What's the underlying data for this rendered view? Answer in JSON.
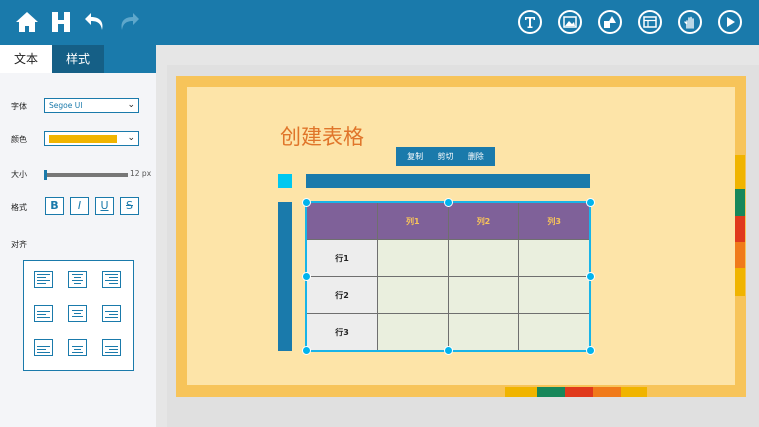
{
  "toolbar": {
    "left_icons": [
      "home-icon",
      "save-icon",
      "undo-icon",
      "redo-icon"
    ],
    "right_icons": [
      "text-icon",
      "image-icon",
      "shapes-icon",
      "table-icon",
      "gesture-icon",
      "play-icon"
    ]
  },
  "tabs": {
    "text": "文本",
    "style": "样式"
  },
  "props": {
    "font_label": "字体",
    "font_value": "Segoe UI",
    "color_label": "颜色",
    "color_value": "#f0b400",
    "size_label": "大小",
    "size_value": "12 px",
    "format_label": "格式",
    "format_buttons": [
      "B",
      "I",
      "U",
      "S"
    ],
    "align_label": "对齐"
  },
  "slide": {
    "title": "创建表格",
    "context_menu": [
      "复制",
      "剪切",
      "删除"
    ],
    "table": {
      "columns": [
        "",
        "列1",
        "列2",
        "列3"
      ],
      "rows": [
        [
          "行1",
          "",
          "",
          ""
        ],
        [
          "行2",
          "",
          "",
          ""
        ],
        [
          "行3",
          "",
          "",
          ""
        ]
      ]
    }
  },
  "colors": {
    "topbar": "#1a7aab",
    "slide_border": "#f7c45a",
    "slide_fill": "#fde4a8",
    "title": "#e0752a",
    "table_header": "#7f6199"
  }
}
